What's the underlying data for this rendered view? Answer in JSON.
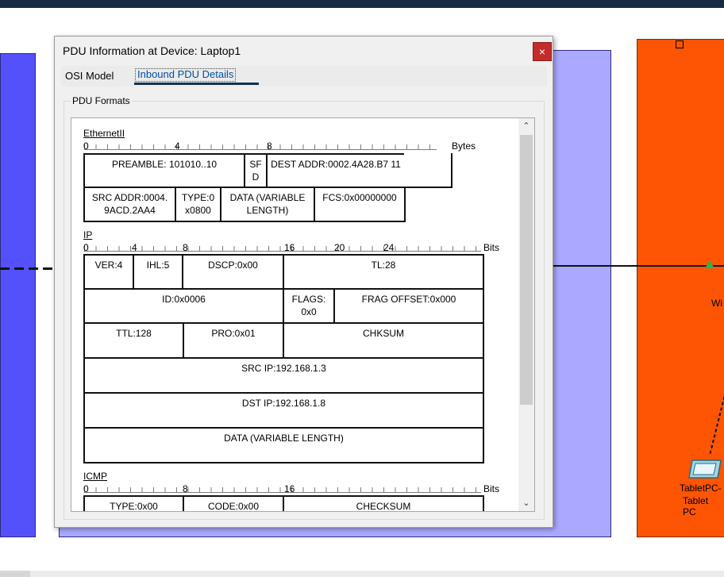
{
  "canvas": {
    "side_text": "Wi",
    "device_label_1": "TabletPC-",
    "device_label_2": "Tablet PC"
  },
  "dialog": {
    "title": "PDU Information at Device: Laptop1",
    "close_glyph": "×",
    "tabs": [
      {
        "label": "OSI Model",
        "active": false
      },
      {
        "label": "Inbound PDU Details",
        "active": true
      }
    ],
    "group_label": "PDU Formats",
    "scroll_up_glyph": "⌃",
    "scroll_down_glyph": "⌄"
  },
  "ethernet": {
    "title": "EthernetII",
    "ticks": [
      "0",
      "4",
      "8"
    ],
    "unit": "Bytes",
    "fields": [
      "PREAMBLE: 101010..10",
      "SF D",
      "DEST ADDR:0002.4A28.B7 11",
      "",
      "SRC ADDR:0004. 9ACD.2AA4",
      "TYPE:0 x0800",
      "DATA (VARIABLE LENGTH)",
      "FCS:0x00000000"
    ]
  },
  "ip": {
    "title": "IP",
    "ticks": [
      "0",
      "4",
      "8",
      "16",
      "20",
      "24"
    ],
    "unit": "Bits",
    "fields": [
      "VER:4",
      "IHL:5",
      "DSCP:0x00",
      "TL:28",
      "ID:0x0006",
      "FLAGS: 0x0",
      "FRAG OFFSET:0x000",
      "TTL:128",
      "PRO:0x01",
      "CHKSUM",
      "SRC IP:192.168.1.3",
      "DST IP:192.168.1.8",
      "DATA (VARIABLE LENGTH)"
    ]
  },
  "icmp": {
    "title": "ICMP",
    "ticks": [
      "0",
      "8",
      "16"
    ],
    "unit": "Bits",
    "fields": [
      "TYPE:0x00",
      "CODE:0x00",
      "CHECKSUM"
    ]
  }
}
